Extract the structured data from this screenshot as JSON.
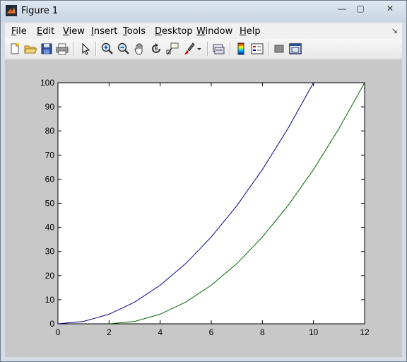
{
  "window": {
    "title": "Figure 1",
    "minimize": "—",
    "maximize": "▢",
    "close": "✕"
  },
  "menu": {
    "file": "File",
    "file_mn": "F",
    "file_rest": "ile",
    "edit": "Edit",
    "edit_mn": "E",
    "edit_rest": "dit",
    "view": "View",
    "view_mn": "V",
    "view_rest": "iew",
    "insert": "Insert",
    "insert_mn": "I",
    "insert_rest": "nsert",
    "tools": "Tools",
    "tools_mn": "T",
    "tools_rest": "ools",
    "desktop": "Desktop",
    "desktop_mn": "D",
    "desktop_rest": "esktop",
    "window": "Window",
    "window_mn": "W",
    "window_rest": "indow",
    "help": "Help",
    "help_mn": "H",
    "help_rest": "elp"
  },
  "toolbar": {
    "icons": [
      "new-figure-icon",
      "open-file-icon",
      "save-icon",
      "print-icon",
      "edit-plot-arrow-icon",
      "zoom-in-icon",
      "zoom-out-icon",
      "pan-hand-icon",
      "rotate-3d-icon",
      "data-cursor-icon",
      "brush-icon",
      "brush-dropdown-icon",
      "link-plot-icon",
      "insert-colorbar-icon",
      "insert-legend-icon",
      "hide-plot-tools-icon",
      "show-plot-tools-icon"
    ]
  },
  "colors": {
    "series1": "#00008b",
    "series2": "#006400",
    "figure_bg": "#c8c8c8"
  },
  "chart_data": {
    "type": "line",
    "title": "",
    "xlabel": "",
    "ylabel": "",
    "xlim": [
      0,
      12
    ],
    "ylim": [
      0,
      100
    ],
    "xticks": [
      0,
      2,
      4,
      6,
      8,
      10,
      12
    ],
    "yticks": [
      0,
      10,
      20,
      30,
      40,
      50,
      60,
      70,
      80,
      90,
      100
    ],
    "grid": false,
    "series": [
      {
        "color": "#00008b",
        "x": [
          0,
          1,
          2,
          3,
          4,
          5,
          6,
          7,
          8,
          9,
          10
        ],
        "y": [
          0,
          1,
          4,
          9,
          16,
          25,
          36,
          49,
          64,
          81,
          100
        ]
      },
      {
        "color": "#006400",
        "x": [
          2,
          3,
          4,
          5,
          6,
          7,
          8,
          9,
          10,
          11,
          12
        ],
        "y": [
          0,
          1,
          4,
          9,
          16,
          25,
          36,
          49,
          64,
          81,
          100
        ]
      }
    ]
  }
}
